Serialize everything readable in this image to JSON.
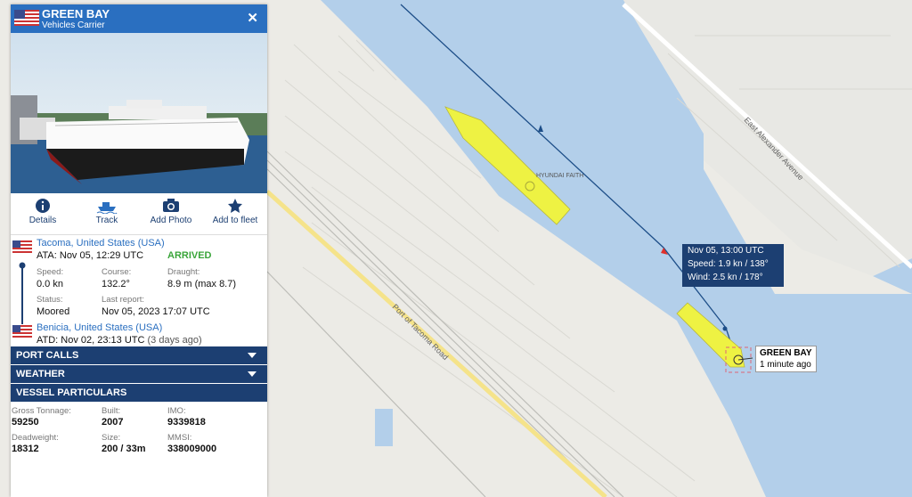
{
  "vessel": {
    "name": "GREEN BAY",
    "type": "Vehicles Carrier",
    "close_icon": "close-icon"
  },
  "actions": [
    {
      "label": "Details",
      "icon": "info-icon"
    },
    {
      "label": "Track",
      "icon": "ship-icon"
    },
    {
      "label": "Add Photo",
      "icon": "camera-icon"
    },
    {
      "label": "Add to fleet",
      "icon": "star-icon"
    }
  ],
  "arrival": {
    "port": "Tacoma, United States (USA)",
    "ata": "ATA: Nov 05, 12:29 UTC",
    "status_badge": "ARRIVED"
  },
  "stats": {
    "speed_label": "Speed:",
    "speed": "0.0 kn",
    "course_label": "Course:",
    "course": "132.2°",
    "draught_label": "Draught:",
    "draught": "8.9 m (max 8.7)",
    "status_label": "Status:",
    "status": "Moored",
    "last_report_label": "Last report:",
    "last_report": "Nov 05, 2023 17:07 UTC"
  },
  "departure": {
    "port": "Benicia, United States (USA)",
    "atd": "ATD: Nov 02, 23:13 UTC",
    "ago": "(3 days ago)"
  },
  "sections": {
    "port_calls": "PORT CALLS",
    "weather": "WEATHER",
    "particulars": "VESSEL PARTICULARS"
  },
  "particulars": {
    "gt_label": "Gross Tonnage:",
    "gt": "59250",
    "built_label": "Built:",
    "built": "2007",
    "imo_label": "IMO:",
    "imo": "9339818",
    "dwt_label": "Deadweight:",
    "dwt": "18312",
    "size_label": "Size:",
    "size": "200 / 33m",
    "mmsi_label": "MMSI:",
    "mmsi": "338009000"
  },
  "map": {
    "other_ship": "HYUNDAI FAITH",
    "road1": "East Alexander Avenue",
    "road2": "Port of Tacoma Road",
    "tooltip": {
      "time": "Nov 05, 13:00 UTC",
      "speed": "Speed: 1.9 kn / 138°",
      "wind": "Wind: 2.5 kn / 178°"
    },
    "ship_label": "GREEN BAY",
    "ship_ago": "1 minute ago"
  },
  "colors": {
    "header": "#2a6fc0",
    "bar": "#1c3f72",
    "arrived": "#3aa53a",
    "water": "#b3cfea",
    "ship": "#eef243"
  }
}
